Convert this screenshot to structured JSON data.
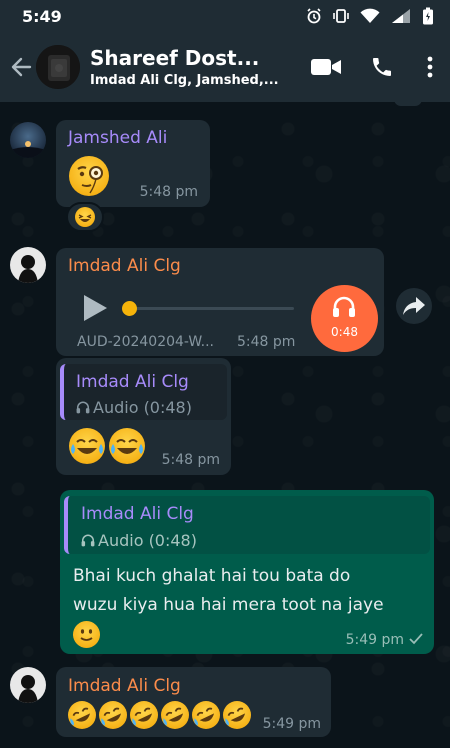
{
  "status_bar": {
    "time": "5:49"
  },
  "header": {
    "title": "Shareef Dost...",
    "subtitle": "Imdad Ali Clg, Jamshed,..."
  },
  "messages": [
    {
      "sender": "Jamshed Ali",
      "time": "5:48 pm",
      "reaction": "laughing",
      "content": "monocle-emoji"
    },
    {
      "sender": "Imdad Ali Clg",
      "audio_file": "AUD-20240204-W...",
      "time": "5:48 pm",
      "duration": "0:48",
      "progress": 0
    },
    {
      "sender": "Imdad Ali Clg",
      "quote_sender": "Imdad Ali Clg",
      "quote_text": "Audio (0:48)",
      "time": "5:48 pm",
      "content": "tears-of-joy x2"
    },
    {
      "quote_sender": "Imdad Ali Clg",
      "quote_text": "Audio (0:48)",
      "text_line1": "Bhai kuch ghalat hai tou bata do",
      "text_line2": "wuzu kiya hua hai mera toot na jaye",
      "time": "5:49 pm",
      "status": "sent"
    },
    {
      "sender": "Imdad Ali Clg",
      "time": "5:49 pm",
      "content": "rolling-on-floor-laughing x6"
    }
  ],
  "colors": {
    "background": "#0b141a",
    "appbar": "#1f2c34",
    "incoming": "#1f2c34",
    "outgoing": "#005c4b",
    "sender_jamshed": "#a78bfa",
    "sender_imdad": "#fb8c4b",
    "quote_sender": "#a78bfa",
    "audio_accent": "#ff6a3d",
    "meta": "#8696a0"
  }
}
